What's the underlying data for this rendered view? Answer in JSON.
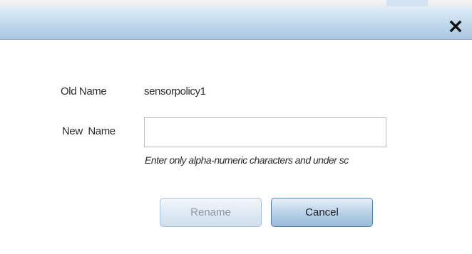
{
  "dialog": {
    "close_icon": "close-icon"
  },
  "form": {
    "old_name_label": "Old Name",
    "old_name_value": "sensorpolicy1",
    "new_name_label": "New  Name",
    "new_name_value": "",
    "new_name_placeholder": "",
    "hint": "Enter only alpha-numeric characters and under sc"
  },
  "buttons": {
    "rename_label": "Rename",
    "cancel_label": "Cancel"
  },
  "colors": {
    "titlebar": "#c6dcee",
    "button_border": "#4f7ea6",
    "disabled_text": "#8a96a2"
  }
}
